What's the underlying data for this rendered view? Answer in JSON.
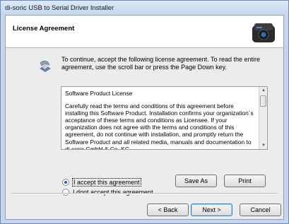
{
  "window": {
    "title": "di-soric  USB to Serial Driver Installer"
  },
  "header": {
    "title": "License Agreement",
    "logo_icon": "device-logo"
  },
  "intro": "To continue, accept the following license agreement. To read the entire agreement, use the scroll bar or press the Page Down key.",
  "license": {
    "heading": "Software Product License",
    "body": "Carefully read the terms and conditions of this agreement before installing this Software Product.  Installation confirms your organization´s acceptance of these terms and conditions as Licensee.  If your organization does not agree with the terms and conditions of this agreement, do not continue with installation, and promptly return the Software Product and all related media, manuals and documentation to di-soric GmbH & Co. KG"
  },
  "options": {
    "accept_label": "I accept this agreement",
    "decline_label": "I dont accept this agreement",
    "selected": "accept"
  },
  "buttons": {
    "save_as": "Save As",
    "print": "Print",
    "back": "< Back",
    "next": "Next >",
    "cancel": "Cancel"
  }
}
